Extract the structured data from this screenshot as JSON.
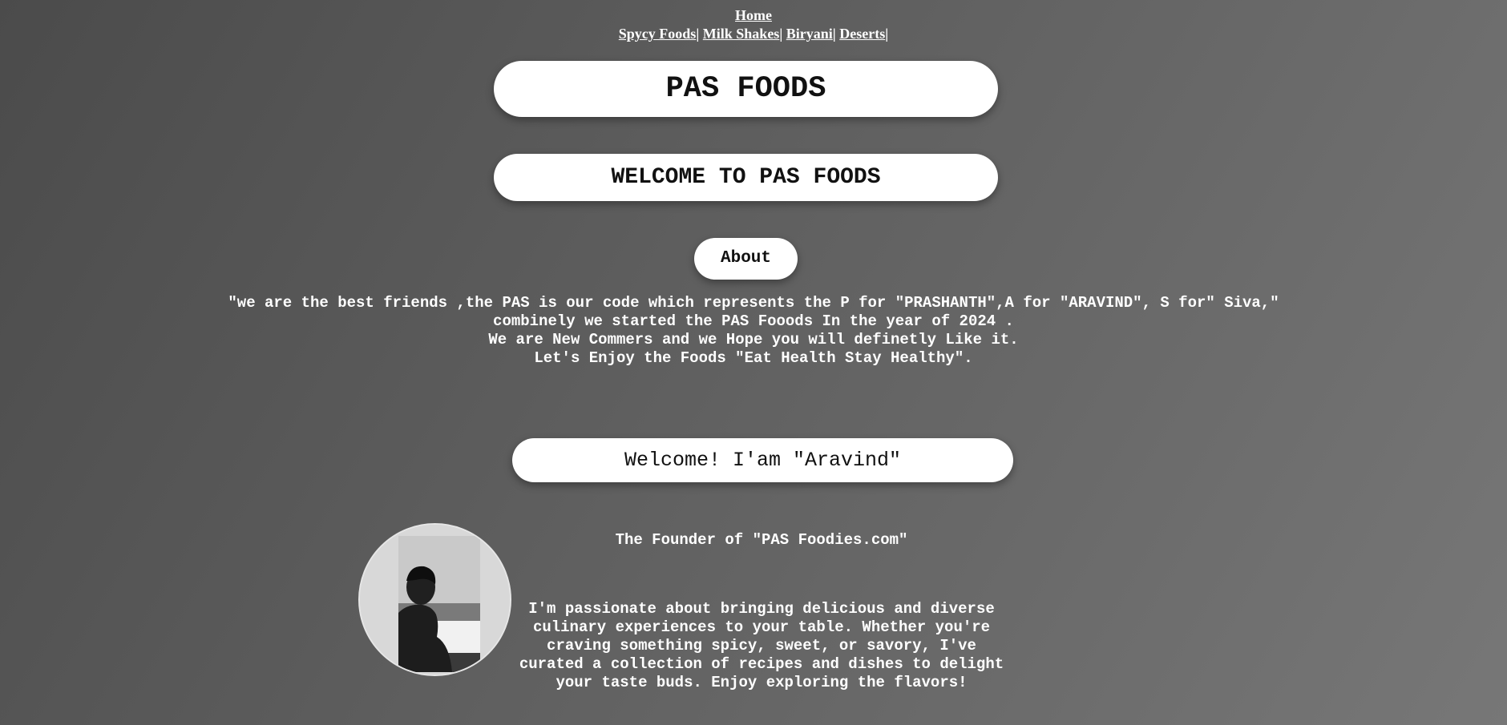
{
  "nav": {
    "home": "Home",
    "links": [
      "Spycy Foods",
      "Milk Shakes",
      "Biryani",
      "Deserts"
    ],
    "separator": "|"
  },
  "header": {
    "title": "PAS FOODS",
    "welcome": "WELCOME TO PAS FOODS"
  },
  "about": {
    "button_label": "About",
    "lines": [
      "\"we are the best friends ,the PAS is our code which represents the P for \"PRASHANTH\",A for \"ARAVIND\", S for\" Siva,\"",
      "combinely we started the PAS Fooods In the year of 2024 .",
      "We are New Commers and we Hope you will definetly Like it.",
      "Let's Enjoy the Foods \"Eat Health Stay Healthy\"."
    ]
  },
  "founder": {
    "greeting": "Welcome! I'am \"Aravind\"",
    "subtitle": "The Founder of \"PAS Foodies.com\"",
    "bio": "I'm passionate about bringing delicious and diverse culinary experiences to your table. Whether you're craving something spicy, sweet, or savory, I've curated a collection of recipes and dishes to delight your taste buds. Enjoy exploring the flavors!",
    "avatar_alt": "founder-photo"
  }
}
